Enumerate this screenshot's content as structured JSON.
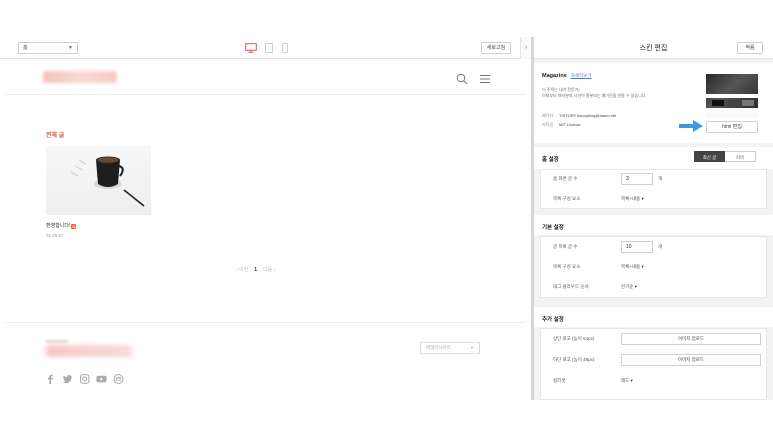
{
  "preview": {
    "view_select": "홈",
    "refresh_label": "새로고침",
    "collapse_glyph": "›",
    "category_title": "전체 글",
    "post_title": "환영합니다!",
    "post_badge": "N",
    "post_date": "01:29:57",
    "pagination": {
      "prev": "‹ 이전",
      "current": "1",
      "next": "다음 ›"
    },
    "family_select": "패밀리사이트"
  },
  "editor": {
    "title": "스킨 편집",
    "apply_label": "적용",
    "skin_name": "Magazine",
    "skin_link": "자세히보기",
    "skin_desc_line1": "더 주목는 내가 전문가!",
    "skin_desc_line2": "이제부터 여러분의 시선이 흥분되는 매거진을 만들 수 있습니다.",
    "maker_label": "제작자",
    "maker_value": "TISTORY tistoryblog@daum.net",
    "license_label": "저작권",
    "license_value": "MIT License",
    "html_edit_label": "html 편집",
    "home": {
      "title": "홈 설정",
      "seg_on": "최신 글",
      "seg_off": "커버",
      "rows": [
        {
          "label": "홈 화면 글 수",
          "value": "3",
          "unit": "개"
        },
        {
          "label": "목록 구성 요소",
          "value": "목록+내용 ▾"
        }
      ]
    },
    "basic": {
      "title": "기본 설정",
      "rows": [
        {
          "label": "글 목록 글 수",
          "value": "10",
          "unit": "개"
        },
        {
          "label": "목록 구성 요소",
          "value": "목록+내용 ▾"
        },
        {
          "label": "태그 클라우드 순서",
          "value": "인기순 ▾"
        }
      ]
    },
    "extra": {
      "title": "추가 설정",
      "rows": [
        {
          "label": "상단 로고 (높이 64px)",
          "button": "이미지 업로드"
        },
        {
          "label": "하단 로고 (높이 48px)",
          "button": "이미지 업로드"
        },
        {
          "label": "컬러셋",
          "value": "레드 ▾"
        }
      ]
    }
  },
  "colors": {
    "accent_red": "#e0574b",
    "arrow_blue": "#3d9be0",
    "badge_orange": "#ef6a33"
  }
}
